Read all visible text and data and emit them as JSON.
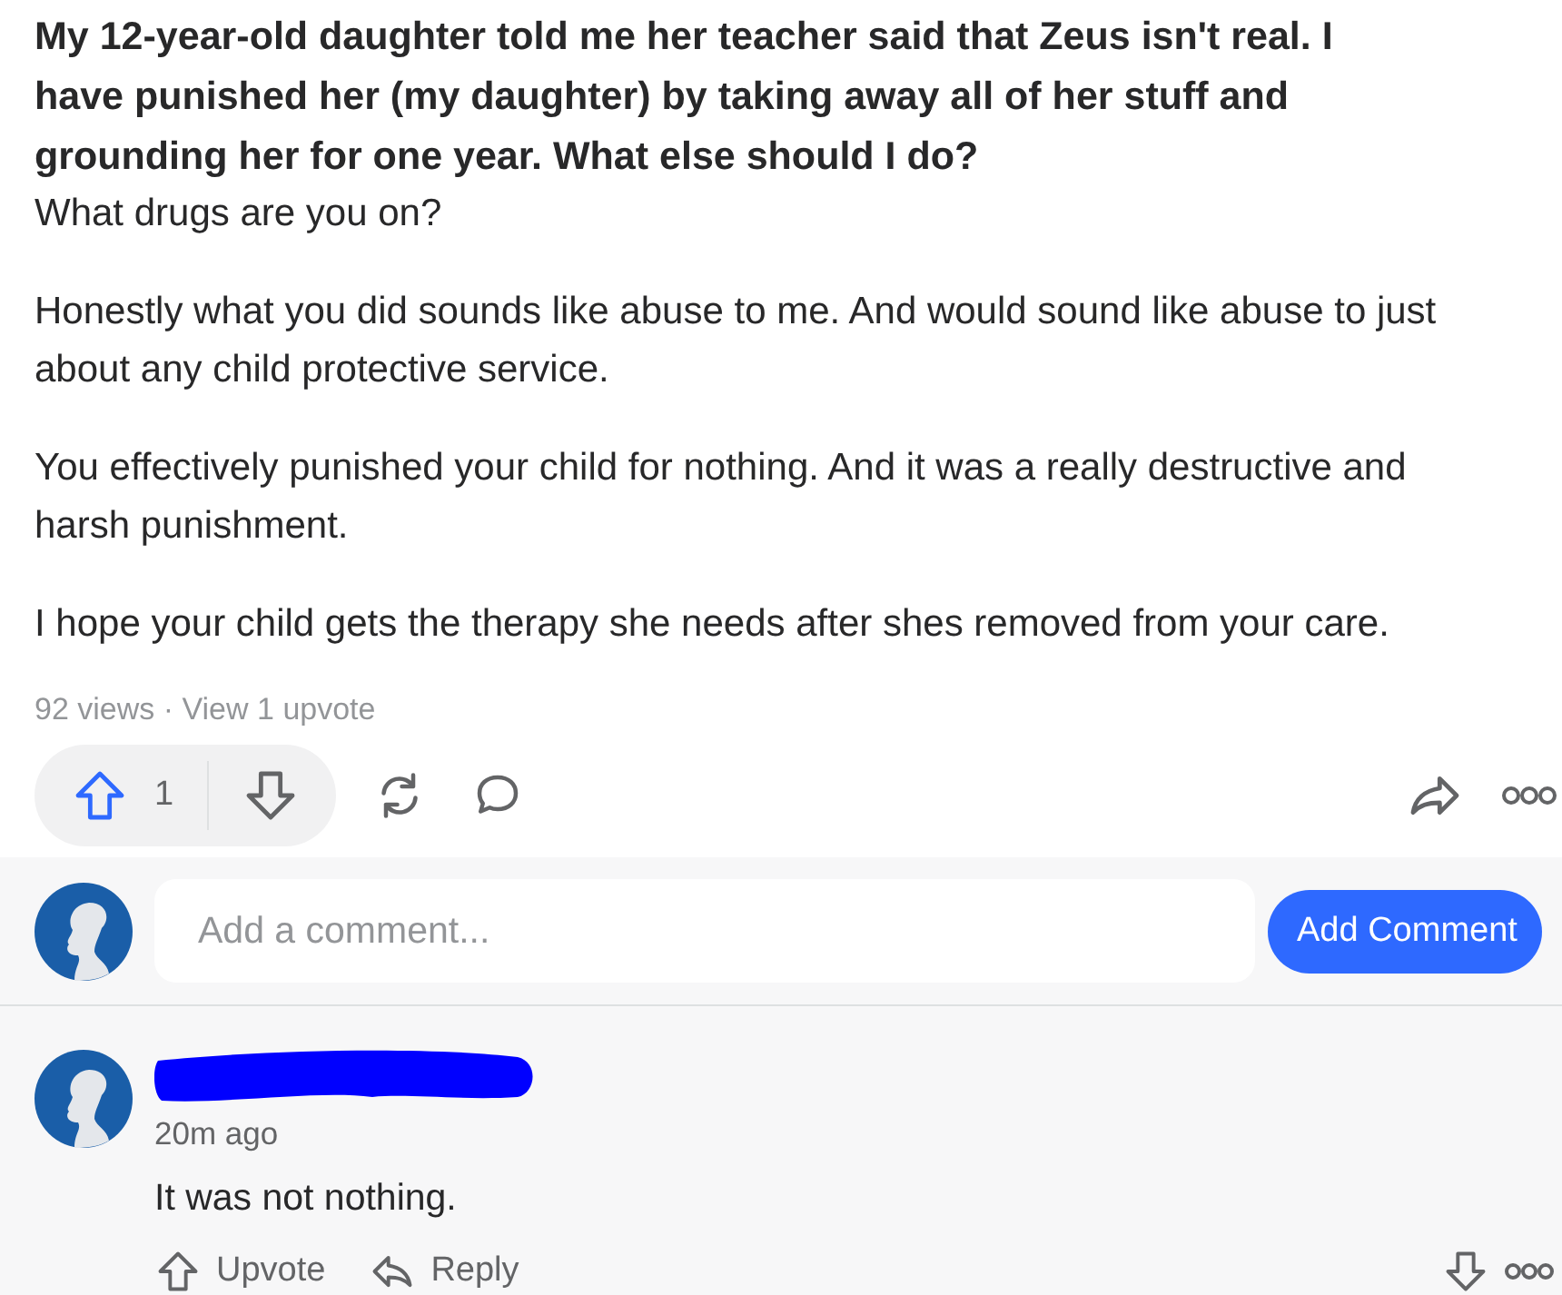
{
  "question": {
    "title": "My 12-year-old daughter told me her teacher said that Zeus isn't real. I have punished her (my daughter) by taking away all of her stuff and grounding her for one year. What else should I do?"
  },
  "answer": {
    "paragraphs": [
      "What drugs are you on?",
      "Honestly what you did sounds like abuse to me. And would sound like abuse to just about any child protective service.",
      "You effectively punished your child for nothing. And it was a really destructive and harsh punishment.",
      "I hope your child gets the therapy she needs after shes removed from your care."
    ],
    "stats": "92 views · View 1 upvote"
  },
  "actions": {
    "upvote_count": "1",
    "upvoted": true
  },
  "composer": {
    "placeholder": "Add a comment...",
    "button": "Add Comment"
  },
  "comments": [
    {
      "time": "20m ago",
      "text": "It was not nothing.",
      "actions": [
        "Upvote",
        "Reply"
      ]
    }
  ]
}
